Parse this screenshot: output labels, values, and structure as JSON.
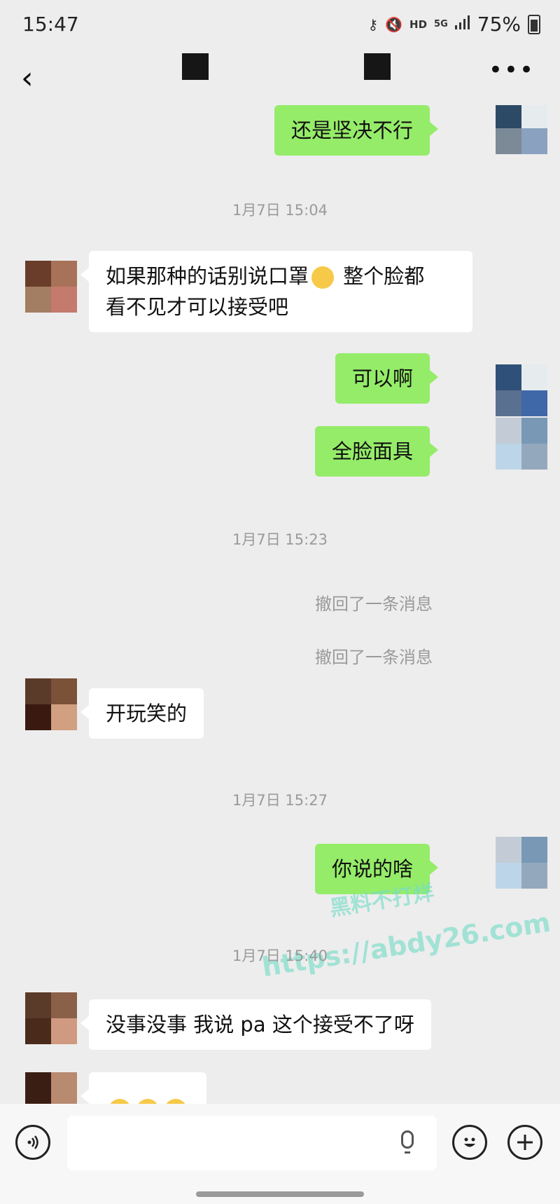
{
  "status_bar": {
    "time": "15:47",
    "net_hd": "HD",
    "net_5g": "5G",
    "battery": "75%"
  },
  "header": {
    "back": "‹",
    "more": "•••"
  },
  "messages": {
    "m1": "还是坚决不行",
    "t1": "1月7日 15:04",
    "m2a": "如果那种的话别说口罩",
    "m2b": " 整个脸都",
    "m2c": "看不见才可以接受吧",
    "m3": "可以啊",
    "m4": "全脸面具",
    "t2": "1月7日 15:23",
    "s1": "撤回了一条消息",
    "s2": "撤回了一条消息",
    "m5": "开玩笑的",
    "t3": "1月7日 15:27",
    "m6": "你说的啥",
    "t4": "1月7日 15:40",
    "m7": "没事没事 我说 pa 这个接受不了呀"
  },
  "watermark": {
    "line1": "黑料不打烊",
    "line2": "https://abdy26.com"
  },
  "colors": {
    "outgoing_bubble": "#95ec69",
    "incoming_bubble": "#ffffff",
    "background": "#ededed"
  }
}
